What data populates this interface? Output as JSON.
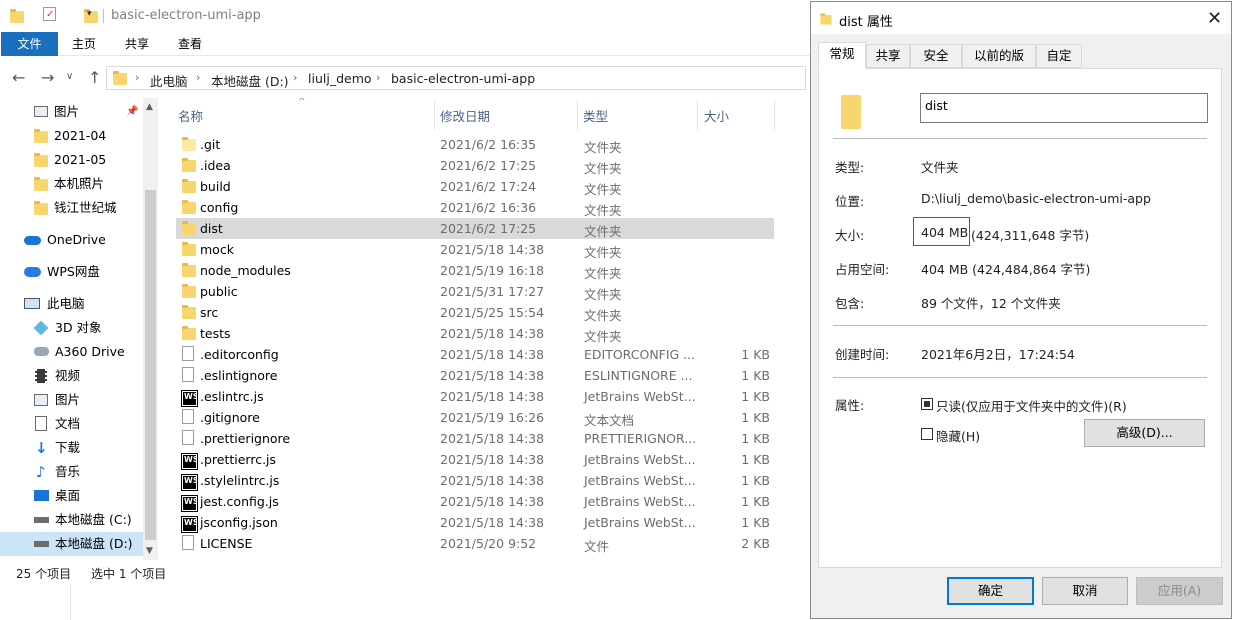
{
  "explorer": {
    "title": "basic-electron-umi-app",
    "ribbon_tabs": [
      "文件",
      "主页",
      "共享",
      "查看"
    ],
    "breadcrumb": [
      "此电脑",
      "本地磁盘 (D:)",
      "liulj_demo",
      "basic-electron-umi-app"
    ],
    "sidebar": {
      "items": [
        {
          "label": "图片",
          "icon": "pictures-icon",
          "pinned": true
        },
        {
          "label": "2021-04",
          "icon": "folder-icon"
        },
        {
          "label": "2021-05",
          "icon": "folder-icon"
        },
        {
          "label": "本机照片",
          "icon": "folder-icon"
        },
        {
          "label": "钱江世纪城",
          "icon": "folder-icon"
        },
        {
          "label": "OneDrive",
          "icon": "onedrive-icon"
        },
        {
          "label": "WPS网盘",
          "icon": "wps-cloud-icon"
        },
        {
          "label": "此电脑",
          "icon": "computer-icon"
        },
        {
          "label": "3D 对象",
          "icon": "3d-objects-icon"
        },
        {
          "label": "A360 Drive",
          "icon": "a360-drive-icon"
        },
        {
          "label": "视频",
          "icon": "videos-icon"
        },
        {
          "label": "图片",
          "icon": "pictures-icon"
        },
        {
          "label": "文档",
          "icon": "documents-icon"
        },
        {
          "label": "下载",
          "icon": "downloads-icon"
        },
        {
          "label": "音乐",
          "icon": "music-icon"
        },
        {
          "label": "桌面",
          "icon": "desktop-icon"
        },
        {
          "label": "本地磁盘 (C:)",
          "icon": "drive-icon"
        },
        {
          "label": "本地磁盘 (D:)",
          "icon": "drive-icon",
          "selected": true
        }
      ]
    },
    "columns": {
      "name": "名称",
      "date": "修改日期",
      "type": "类型",
      "size": "大小"
    },
    "files": [
      {
        "name": ".git",
        "date": "2021/6/2 16:35",
        "type": "文件夹",
        "size": "",
        "icon": "folder-light"
      },
      {
        "name": ".idea",
        "date": "2021/6/2 17:25",
        "type": "文件夹",
        "size": "",
        "icon": "folder"
      },
      {
        "name": "build",
        "date": "2021/6/2 17:24",
        "type": "文件夹",
        "size": "",
        "icon": "folder"
      },
      {
        "name": "config",
        "date": "2021/6/2 16:36",
        "type": "文件夹",
        "size": "",
        "icon": "folder"
      },
      {
        "name": "dist",
        "date": "2021/6/2 17:25",
        "type": "文件夹",
        "size": "",
        "icon": "folder",
        "selected": true
      },
      {
        "name": "mock",
        "date": "2021/5/18 14:38",
        "type": "文件夹",
        "size": "",
        "icon": "folder"
      },
      {
        "name": "node_modules",
        "date": "2021/5/19 16:18",
        "type": "文件夹",
        "size": "",
        "icon": "folder"
      },
      {
        "name": "public",
        "date": "2021/5/31 17:27",
        "type": "文件夹",
        "size": "",
        "icon": "folder"
      },
      {
        "name": "src",
        "date": "2021/5/25 15:54",
        "type": "文件夹",
        "size": "",
        "icon": "folder"
      },
      {
        "name": "tests",
        "date": "2021/5/18 14:38",
        "type": "文件夹",
        "size": "",
        "icon": "folder"
      },
      {
        "name": ".editorconfig",
        "date": "2021/5/18 14:38",
        "type": "EDITORCONFIG ...",
        "size": "1 KB",
        "icon": "doc"
      },
      {
        "name": ".eslintignore",
        "date": "2021/5/18 14:38",
        "type": "ESLINTIGNORE ...",
        "size": "1 KB",
        "icon": "doc"
      },
      {
        "name": ".eslintrc.js",
        "date": "2021/5/18 14:38",
        "type": "JetBrains WebSt...",
        "size": "1 KB",
        "icon": "ws"
      },
      {
        "name": ".gitignore",
        "date": "2021/5/19 16:26",
        "type": "文本文档",
        "size": "1 KB",
        "icon": "doc"
      },
      {
        "name": ".prettierignore",
        "date": "2021/5/18 14:38",
        "type": "PRETTIERIGNOR...",
        "size": "1 KB",
        "icon": "doc"
      },
      {
        "name": ".prettierrc.js",
        "date": "2021/5/18 14:38",
        "type": "JetBrains WebSt...",
        "size": "1 KB",
        "icon": "ws"
      },
      {
        "name": ".stylelintrc.js",
        "date": "2021/5/18 14:38",
        "type": "JetBrains WebSt...",
        "size": "1 KB",
        "icon": "ws"
      },
      {
        "name": "jest.config.js",
        "date": "2021/5/18 14:38",
        "type": "JetBrains WebSt...",
        "size": "1 KB",
        "icon": "ws"
      },
      {
        "name": "jsconfig.json",
        "date": "2021/5/18 14:38",
        "type": "JetBrains WebSt...",
        "size": "1 KB",
        "icon": "ws"
      },
      {
        "name": "LICENSE",
        "date": "2021/5/20 9:52",
        "type": "文件",
        "size": "2 KB",
        "icon": "doc"
      }
    ],
    "status": {
      "count": "25 个项目",
      "selected": "选中 1 个项目"
    }
  },
  "dialog": {
    "title": "dist 属性",
    "tabs": [
      "常规",
      "共享",
      "安全",
      "以前的版本",
      "自定义"
    ],
    "name_value": "dist",
    "properties": {
      "type_label": "类型:",
      "type_value": "文件夹",
      "location_label": "位置:",
      "location_value": "D:\\liulj_demo\\basic-electron-umi-app",
      "size_label": "大小:",
      "size_value": "404 MB",
      "size_bytes": "(424,311,648 字节)",
      "disk_label": "占用空间:",
      "disk_value": "404 MB (424,484,864 字节)",
      "contains_label": "包含:",
      "contains_value": "89 个文件，12 个文件夹",
      "created_label": "创建时间:",
      "created_value": "2021年6月2日，17:24:54",
      "attr_label": "属性:",
      "readonly_label": "只读(仅应用于文件夹中的文件)(R)",
      "hidden_label": "隐藏(H)",
      "advanced_label": "高级(D)..."
    },
    "buttons": {
      "ok": "确定",
      "cancel": "取消",
      "apply": "应用(A)"
    }
  },
  "colors": {
    "accent": "#1a6fbf",
    "selection": "#d9d9d9",
    "highlight_box": "#e0202a"
  }
}
